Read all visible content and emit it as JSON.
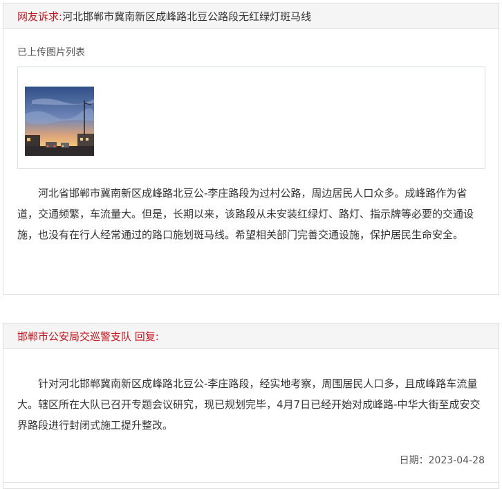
{
  "complaint": {
    "label": "网友诉求:",
    "title": "河北邯郸市冀南新区成峰路北豆公路段无红绿灯斑马线",
    "uploaded_images_label": "已上传图片列表",
    "images": [
      {
        "alt": "街道黄昏照片"
      }
    ],
    "content": "河北省邯郸市冀南新区成峰路北豆公-李庄路段为过村公路，周边居民人口众多。成峰路作为省道，交通频繁，车流量大。但是，长期以来，该路段从未安装红绿灯、路灯、指示牌等必要的交通设施，也没有在行人经常通过的路口施划斑马线。希望相关部门完善交通设施，保护居民生命安全。"
  },
  "reply": {
    "label": "邯郸市公安局交巡警支队 回复:",
    "content": "针对河北邯郸冀南新区成峰路北豆公-李庄路段，经实地考察，周围居民人口多，且成峰路车流量大。辖区所在大队已召开专题会议研究，现已规划完毕，4月7日已经开始对成峰路-中华大街至成安交界路段进行封闭式施工提升整改。",
    "date_label": "日期：",
    "date": "2023-04-28"
  },
  "colors": {
    "accent_red": "#c8161d",
    "header_bg": "#f5f5f5",
    "border": "#dcdcdc"
  }
}
